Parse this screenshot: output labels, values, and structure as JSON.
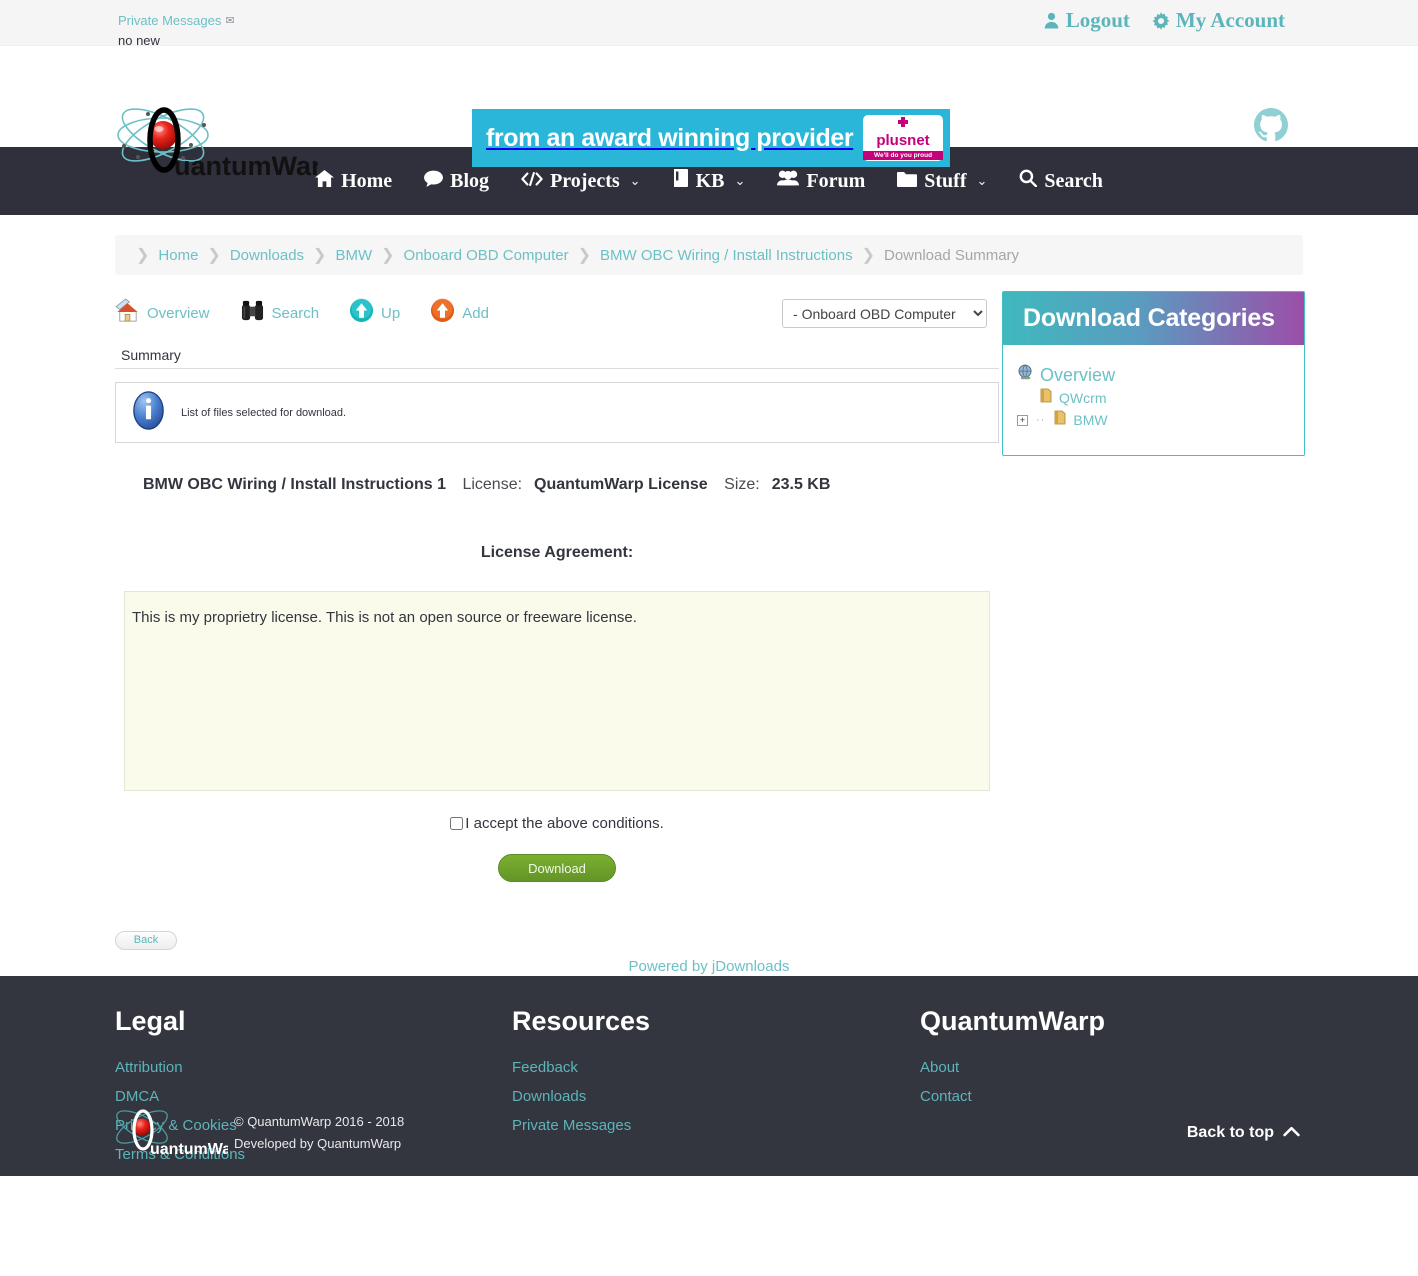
{
  "topbar": {
    "pm_label": "Private Messages",
    "pm_icon": "envelope-icon",
    "pm_status": "no new",
    "logout": "Logout",
    "my_account": "My Account"
  },
  "header": {
    "logo_text": "QuantumWarp",
    "banner_text": "from an award winning provider",
    "banner_brand": "plusnet",
    "banner_tagline": "We'll do you proud",
    "github_icon": "github-icon"
  },
  "nav": {
    "items": [
      {
        "label": "Home",
        "icon": "home-icon",
        "caret": ""
      },
      {
        "label": "Blog",
        "icon": "comment-icon",
        "caret": ""
      },
      {
        "label": "Projects",
        "icon": "code-icon",
        "caret": "⌄"
      },
      {
        "label": "KB",
        "icon": "book-icon",
        "caret": "⌄"
      },
      {
        "label": "Forum",
        "icon": "users-icon",
        "caret": ""
      },
      {
        "label": "Stuff",
        "icon": "folder-icon",
        "caret": "⌄"
      },
      {
        "label": "Search",
        "icon": "search-icon",
        "caret": ""
      }
    ]
  },
  "breadcrumb": {
    "items": [
      {
        "label": "Home",
        "current": false
      },
      {
        "label": "Downloads",
        "current": false
      },
      {
        "label": "BMW",
        "current": false
      },
      {
        "label": "Onboard OBD Computer",
        "current": false
      },
      {
        "label": "BMW OBC Wiring / Install Instructions",
        "current": false
      },
      {
        "label": "Download Summary",
        "current": true
      }
    ],
    "separator": "❯"
  },
  "toolbar": {
    "items": [
      {
        "label": "Overview",
        "icon": "house-overview-icon"
      },
      {
        "label": "Search",
        "icon": "binoculars-icon"
      },
      {
        "label": "Up",
        "icon": "up-arrow-teal-icon"
      },
      {
        "label": "Add",
        "icon": "up-arrow-orange-icon"
      }
    ],
    "category_select_value": "- Onboard OBD Computer",
    "category_select_options": [
      "- Onboard OBD Computer"
    ]
  },
  "summary": {
    "heading": "Summary",
    "info_icon": "info-icon",
    "info_text": "List of files selected for download."
  },
  "file": {
    "title": "BMW OBC Wiring / Install Instructions 1",
    "license_label": "License:",
    "license_value": "QuantumWarp License",
    "size_label": "Size:",
    "size_value": "23.5 KB"
  },
  "license": {
    "heading": "License Agreement:",
    "body": "This is my proprietry license. This is not an open source or freeware license.",
    "accept_label": "I accept the above conditions.",
    "accept_checked": false,
    "download_button": "Download"
  },
  "bottom": {
    "back_button": "Back",
    "powered_by": "Powered by jDownloads"
  },
  "categories_panel": {
    "title": "Download Categories",
    "items": [
      {
        "label": "Overview",
        "icon": "globe-icon",
        "level": 0,
        "expander": ""
      },
      {
        "label": "QWcrm",
        "icon": "folder-icon",
        "level": 1,
        "expander": ""
      },
      {
        "label": "BMW",
        "icon": "folder-icon",
        "level": 1,
        "expander": "+"
      }
    ]
  },
  "footer": {
    "columns": [
      {
        "title": "Legal",
        "links": [
          "Attribution",
          "DMCA",
          "Privacy & Cookies",
          "Terms & Conditions"
        ]
      },
      {
        "title": "Resources",
        "links": [
          "Feedback",
          "Downloads",
          "Private Messages"
        ]
      },
      {
        "title": "QuantumWarp",
        "links": [
          "About",
          "Contact"
        ]
      }
    ],
    "copyright": "© QuantumWarp 2016 - 2018",
    "developed": "Developed by QuantumWarp",
    "back_to_top": "Back to top",
    "logo_text": "QuantumWarp"
  },
  "colors": {
    "teal": "#6dc0c6",
    "dark": "#33353f",
    "nav_bg": "#2f303b",
    "banner_bg": "#29b6d8",
    "green_button": "#7ab030",
    "license_bg": "#fbfbeb"
  }
}
